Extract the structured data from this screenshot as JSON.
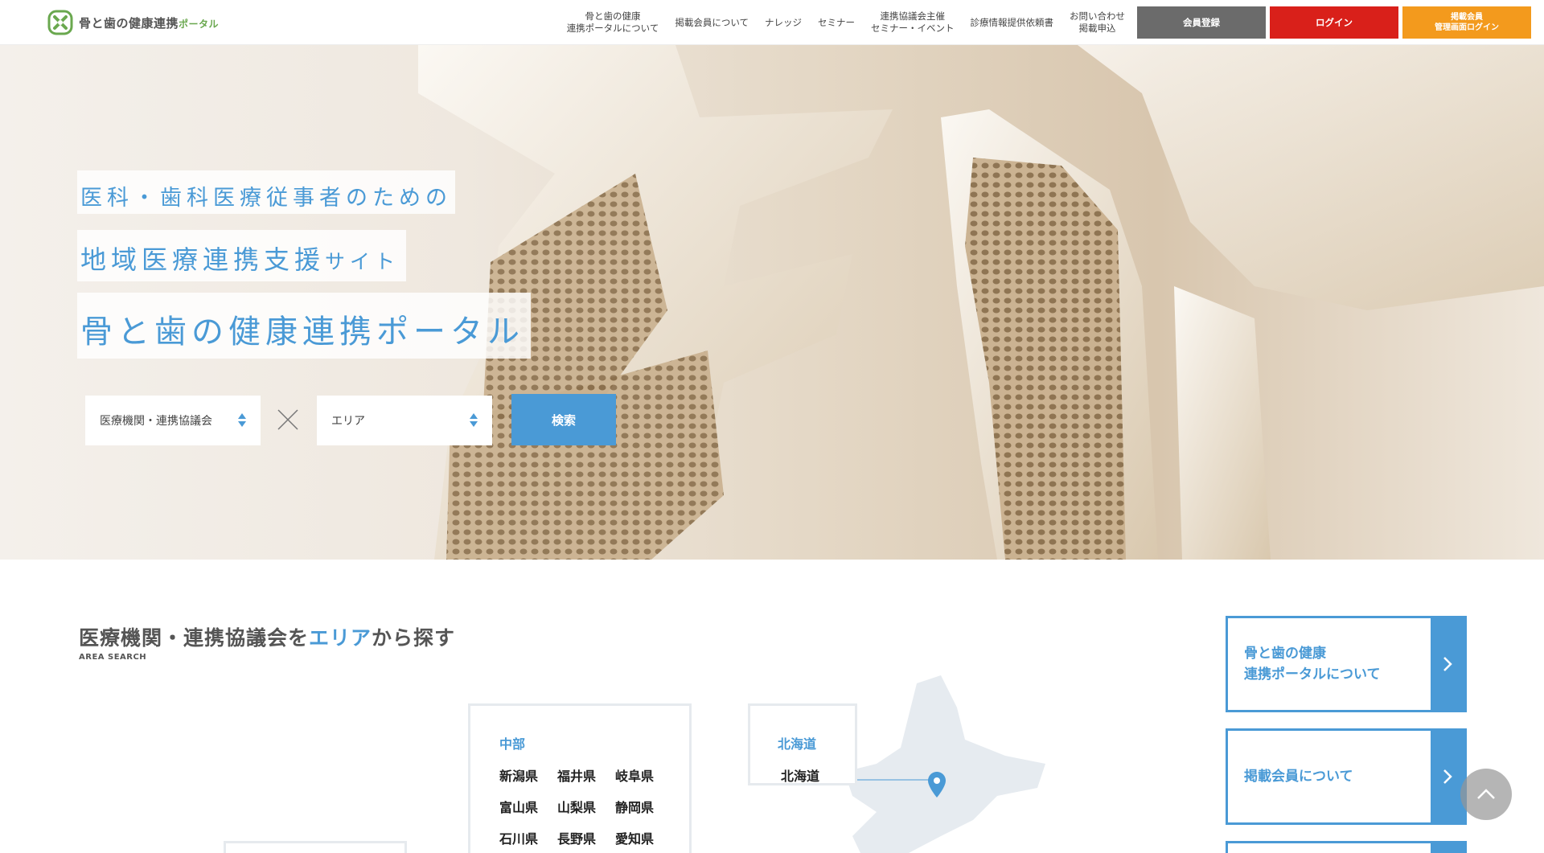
{
  "header": {
    "logo_text": "骨と歯の健康連携",
    "logo_accent": "ポータル",
    "nav": [
      "骨と歯の健康\n連携ポータルについて",
      "掲載会員について",
      "ナレッジ",
      "セミナー",
      "連携協議会主催\nセミナー・イベント",
      "診療情報提供依頼書",
      "お問い合わせ\n掲載申込"
    ],
    "buttons": {
      "register": "会員登録",
      "login": "ログイン",
      "member_login": "掲載会員\n管理画面ログイン"
    }
  },
  "hero": {
    "line1": "医科・歯科医療従事者のための",
    "line2_main": "地域医療連携支援",
    "line2_small": "サイト",
    "line3": "骨と歯の健康連携ポータル",
    "select1": "医療機関・連携協議会",
    "select2": "エリア",
    "search_label": "検索"
  },
  "area_search": {
    "title_a": "医療機関・連携協議会を",
    "title_hl": "エリア",
    "title_b": "から探す",
    "subtitle": "AREA SEARCH",
    "chubu": {
      "region": "中部",
      "prefectures": [
        "新潟県",
        "福井県",
        "岐阜県",
        "富山県",
        "山梨県",
        "静岡県",
        "石川県",
        "長野県",
        "愛知県"
      ]
    },
    "hokkaido": {
      "region": "北海道",
      "prefectures": [
        "北海道"
      ]
    }
  },
  "side_links": [
    "骨と歯の健康\n連携ポータルについて",
    "掲載会員について"
  ],
  "colors": {
    "accent": "#4a9ad6",
    "login": "#d9201a",
    "register": "#6b6b6b",
    "member": "#f39a1d",
    "logo_green": "#6aa84f"
  },
  "icons": [
    "logo-icon",
    "times-icon",
    "chevron-right-icon",
    "map-pin-icon",
    "chevron-up-icon",
    "select-arrows-icon"
  ]
}
